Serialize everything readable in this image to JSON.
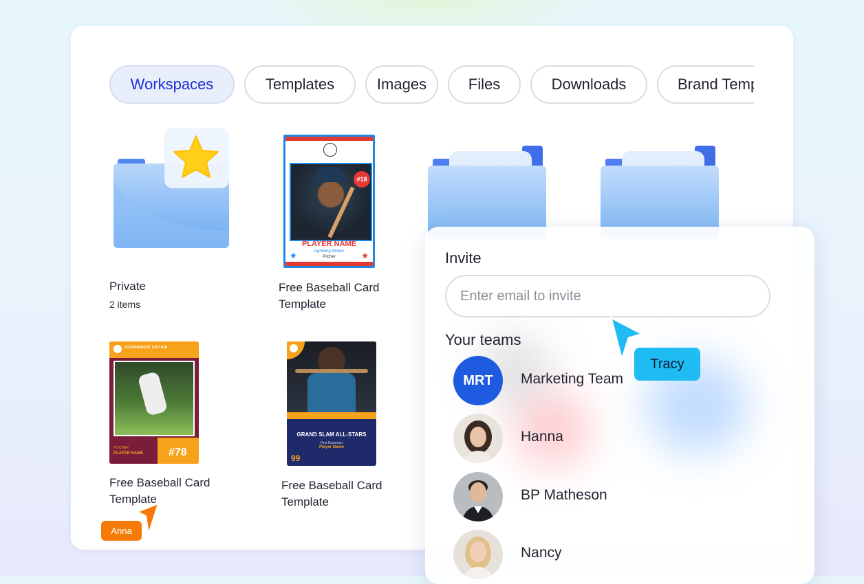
{
  "tabs": [
    {
      "label": "Workspaces",
      "active": true
    },
    {
      "label": "Templates",
      "active": false
    },
    {
      "label": "Images",
      "active": false
    },
    {
      "label": "Files",
      "active": false
    },
    {
      "label": "Downloads",
      "active": false
    },
    {
      "label": "Brand Templates",
      "active": false
    }
  ],
  "items": {
    "private": {
      "title": "Private",
      "subtitle": "2 items",
      "icon": "star-folder-icon"
    },
    "card1": {
      "title": "Free Baseball Card\nTemplate",
      "card_text": {
        "number": "#18",
        "player": "PLAYER NAME",
        "team": "Lightning Strikes",
        "position": "Pitcher"
      }
    },
    "card2": {
      "title": "Free Baseball Card\nTemplate",
      "card_text": {
        "banner": "TOURNAMENT EDITION",
        "position": "PITCHER",
        "player": "PLAYER NAME",
        "number": "#78"
      }
    },
    "card3": {
      "title": "Free Baseball Card\nTemplate",
      "card_text": {
        "headline": "GRAND SLAM ALL-STARS",
        "position": "First Baseman",
        "player": "Player Name",
        "number": "99"
      }
    }
  },
  "invite": {
    "title": "Invite",
    "placeholder": "Enter email to invite",
    "teams_title": "Your teams",
    "members": [
      {
        "name": "Marketing Team",
        "initials": "MRT"
      },
      {
        "name": "Hanna"
      },
      {
        "name": "BP Matheson"
      },
      {
        "name": "Nancy"
      }
    ]
  },
  "cursors": {
    "tracy": {
      "label": "Tracy",
      "color": "#1fbbf3"
    },
    "anna": {
      "label": "Anna",
      "color": "#f57a08"
    }
  },
  "colors": {
    "accent": "#1d2cd8",
    "team_avatar": "#1e5be0"
  }
}
